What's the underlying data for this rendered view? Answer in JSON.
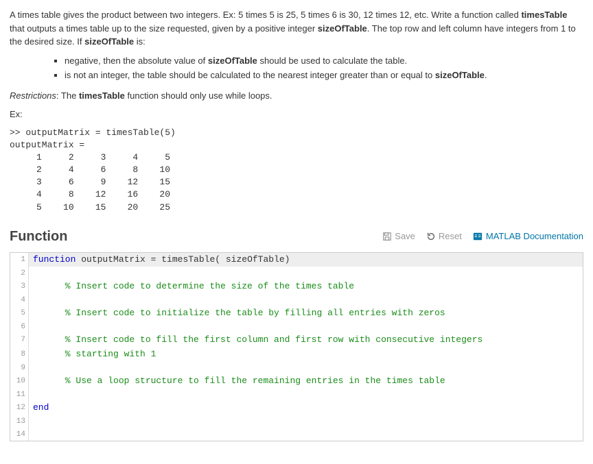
{
  "prompt": {
    "p1a": "A times table gives the product between two integers. Ex: 5 times 5 is 25,  5 times 6 is 30, 12 times 12, etc. Write a function called ",
    "p1b": "timesTable",
    "p1c": " that outputs a times table up to the size requested, given by a positive integer ",
    "p1d": "sizeOfTable",
    "p1e": ".  The top row and left column have integers from 1 to the desired size. If ",
    "p1f": "sizeOfTable",
    "p1g": " is:",
    "li1a": "negative, then the absolute value of ",
    "li1b": "sizeOfTable",
    "li1c": " should be used to calculate the table.",
    "li2a": "is not an integer, the table should be calculated to the nearest integer greater than or equal to ",
    "li2b": "sizeOfTable",
    "li2c": ".",
    "restr_label": "Restrictions",
    "restr_sep": ":  The ",
    "restr_fn": "timesTable",
    "restr_tail": " function should only use while loops.",
    "ex_label": "Ex:"
  },
  "example_output": ">> outputMatrix = timesTable(5)\noutputMatrix =\n     1     2     3     4     5\n     2     4     6     8    10\n     3     6     9    12    15\n     4     8    12    16    20\n     5    10    15    20    25",
  "chart_data": {
    "type": "table",
    "title": "timesTable(5) output",
    "rows": [
      [
        1,
        2,
        3,
        4,
        5
      ],
      [
        2,
        4,
        6,
        8,
        10
      ],
      [
        3,
        6,
        9,
        12,
        15
      ],
      [
        4,
        8,
        12,
        16,
        20
      ],
      [
        5,
        10,
        15,
        20,
        25
      ]
    ]
  },
  "section": {
    "title": "Function",
    "save": "Save",
    "reset": "Reset",
    "doc": "MATLAB Documentation"
  },
  "code": {
    "l1_kw": "function",
    "l1_rest": " outputMatrix = timesTable( sizeOfTable)",
    "l2": "",
    "l3": "      % Insert code to determine the size of the times table",
    "l4": "",
    "l5": "      % Insert code to initialize the table by filling all entries with zeros",
    "l6": "",
    "l7": "      % Insert code to fill the first column and first row with consecutive integers",
    "l8": "      % starting with 1",
    "l9": "",
    "l10": "      % Use a loop structure to fill the remaining entries in the times table",
    "l11": "",
    "l12": "end",
    "l13": "",
    "l14": "",
    "linenums": [
      "1",
      "2",
      "3",
      "4",
      "5",
      "6",
      "7",
      "8",
      "9",
      "10",
      "11",
      "12",
      "13",
      "14"
    ]
  }
}
